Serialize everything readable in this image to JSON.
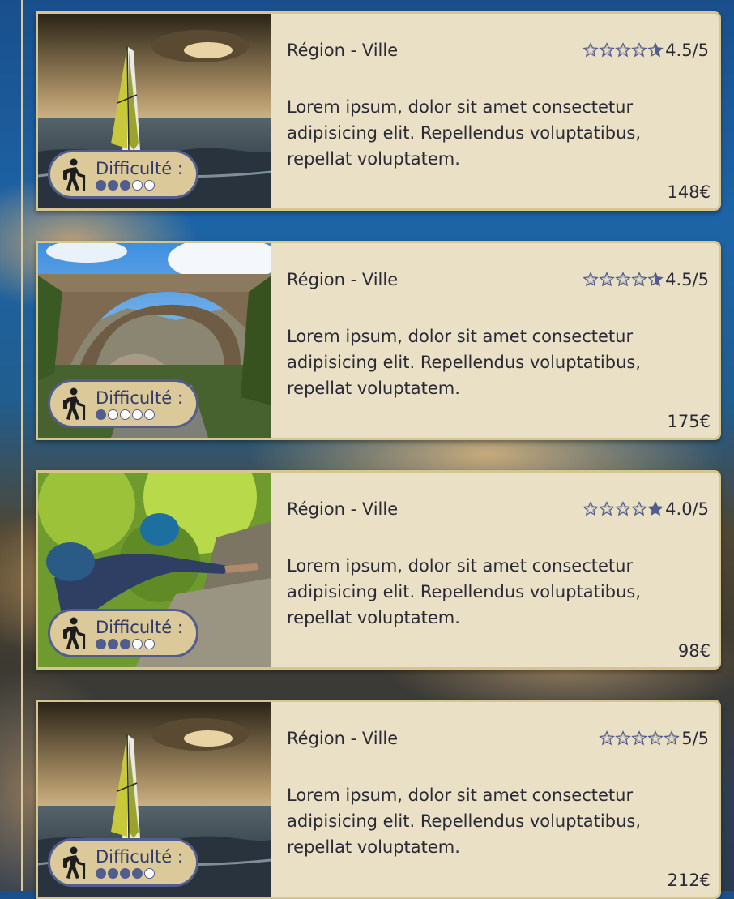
{
  "colors": {
    "card_bg": "#eae0c6",
    "accent": "#515d8e",
    "badge_bg": "#dcc99a"
  },
  "cards": [
    {
      "region": "Région - Ville",
      "rating": "4.5/5",
      "stars": 4.5,
      "description": "Lorem ipsum, dolor sit amet consectetur adipisicing elit. Repellendus voluptatibus, repellat voluptatem.",
      "price": "148€",
      "difficulty_label": "Difficulté :",
      "difficulty": 3,
      "photo": "windsurf"
    },
    {
      "region": "Région - Ville",
      "rating": "4.5/5",
      "stars": 4.5,
      "description": "Lorem ipsum, dolor sit amet consectetur adipisicing elit. Repellendus voluptatibus, repellat voluptatem.",
      "price": "175€",
      "difficulty_label": "Difficulté :",
      "difficulty": 1,
      "photo": "bridge"
    },
    {
      "region": "Région - Ville",
      "rating": "4.0/5",
      "stars": 4.0,
      "description": "Lorem ipsum, dolor sit amet consectetur adipisicing elit. Repellendus voluptatibus, repellat voluptatem.",
      "price": "98€",
      "difficulty_label": "Difficulté :",
      "difficulty": 3,
      "photo": "climber"
    },
    {
      "region": "Région - Ville",
      "rating": "5/5",
      "stars": 5,
      "description": "Lorem ipsum, dolor sit amet consectetur adipisicing elit. Repellendus voluptatibus, repellat voluptatem.",
      "price": "212€",
      "difficulty_label": "Difficulté :",
      "difficulty": 4,
      "photo": "windsurf"
    }
  ]
}
